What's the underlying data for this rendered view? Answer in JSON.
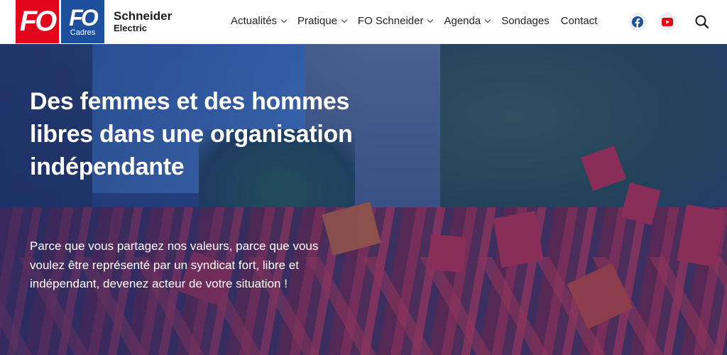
{
  "header": {
    "logo_fo": "FO",
    "logo_fo_cadres": "FO",
    "logo_cadres_label": "Cadres",
    "brand_line1": "Schneider",
    "brand_line2": "Electric"
  },
  "nav": {
    "items": [
      {
        "label": "Actualités",
        "has_dropdown": true
      },
      {
        "label": "Pratique",
        "has_dropdown": true
      },
      {
        "label": "FO Schneider",
        "has_dropdown": true
      },
      {
        "label": "Agenda",
        "has_dropdown": true
      },
      {
        "label": "Sondages",
        "has_dropdown": false
      },
      {
        "label": "Contact",
        "has_dropdown": false
      }
    ],
    "icons": [
      "facebook-icon",
      "youtube-icon",
      "search-icon"
    ]
  },
  "hero": {
    "title": "Des femmes et des hommes libres dans une organisation indépendante",
    "text": "Parce que vous partagez nos valeurs, parce que vous voulez être représenté par un syndicat fort, libre et indépendant, devenez acteur de votre situation !"
  },
  "colors": {
    "fo_red": "#e3051b",
    "fo_blue": "#1d4f9c",
    "facebook_blue": "#1d4f9c",
    "youtube_red": "#e3051b"
  }
}
